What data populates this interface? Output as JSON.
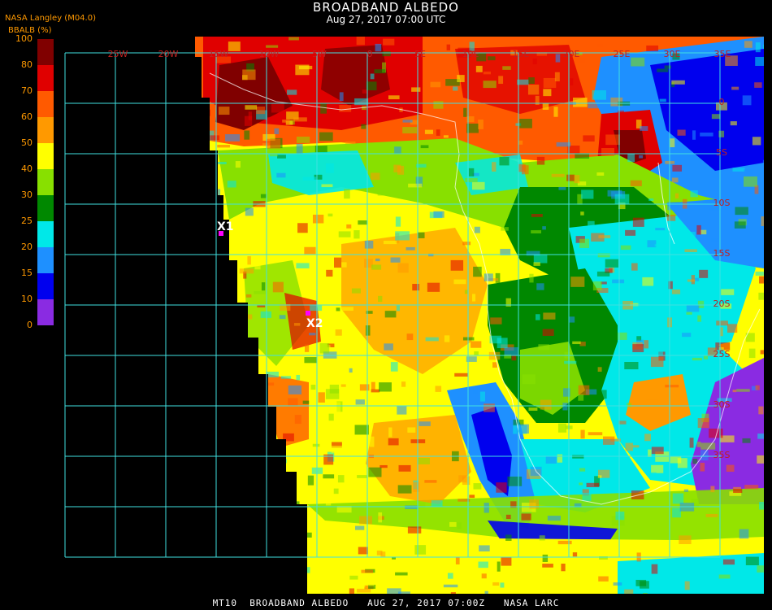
{
  "header": {
    "title": "BROADBAND ALBEDO",
    "datetime": "Aug 27, 2017 07:00 UTC",
    "organization": "NASA Langley (M04.0)",
    "unit_label": "BBALB (%)"
  },
  "colorbar": {
    "ticks": [
      "100",
      "80",
      "70",
      "60",
      "50",
      "40",
      "30",
      "25",
      "20",
      "15",
      "10",
      "0"
    ],
    "colors": [
      "#800000",
      "#e00000",
      "#ff5a00",
      "#ff9900",
      "#ffff00",
      "#88e000",
      "#008800",
      "#00e8e8",
      "#1e90ff",
      "#0000ee",
      "#8a2be2"
    ]
  },
  "map": {
    "lon_labels": [
      "25W",
      "20W",
      "15W",
      "10W",
      "5W",
      "0",
      "5E",
      "10E",
      "15E",
      "20E",
      "25E",
      "30E",
      "35E"
    ],
    "lat_labels": [
      "0",
      "5S",
      "10S",
      "15S",
      "20S",
      "25S",
      "30S",
      "35S"
    ],
    "markers": [
      {
        "label": "X1",
        "color": "#ff00ff"
      },
      {
        "label": "X2",
        "color": "#ff00ff"
      }
    ],
    "grid_color": "#40e0e0"
  },
  "footer": {
    "text": "MT10  BROADBAND ALBEDO   AUG 27, 2017 07:00Z   NASA LARC"
  }
}
